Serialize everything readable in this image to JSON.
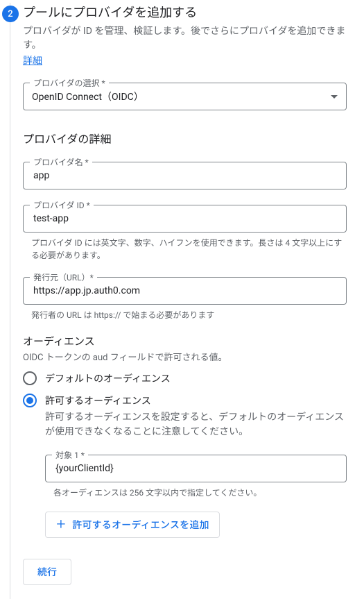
{
  "step": {
    "number": "2",
    "title": "プールにプロバイダを追加する",
    "description": "プロバイダが ID を管理、検証します。後でさらにプロバイダを追加できます。",
    "detailsLink": "詳細"
  },
  "providerSelect": {
    "label": "プロバイダの選択 *",
    "value": "OpenID Connect（OIDC）"
  },
  "detailsSection": {
    "title": "プロバイダの詳細"
  },
  "providerName": {
    "label": "プロバイダ名 *",
    "value": "app"
  },
  "providerId": {
    "label": "プロバイダ ID *",
    "value": "test-app",
    "helper": "プロバイダ ID には英文字、数字、ハイフンを使用できます。長さは 4 文字以上にする必要があります。"
  },
  "issuer": {
    "label": "発行元（URL）*",
    "value": "https://app.jp.auth0.com",
    "helper": "発行者の URL は https:// で始まる必要があります"
  },
  "audience": {
    "title": "オーディエンス",
    "caption": "OIDC トークンの aud フィールドで許可される値。",
    "optionDefault": "デフォルトのオーディエンス",
    "optionAllowed": "許可するオーディエンス",
    "allowedHint": "許可するオーディエンスを設定すると、デフォルトのオーディエンスが使用できなくなることに注意してください。",
    "target": {
      "label": "対象 1 *",
      "value": "{yourClientId}",
      "helper": "各オーディエンスは 256 文字以内で指定してください。"
    },
    "addButton": "許可するオーディエンスを追加"
  },
  "continue": "続行"
}
